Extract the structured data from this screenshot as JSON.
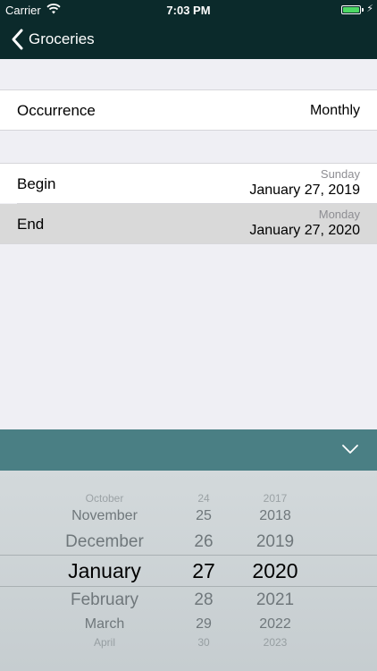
{
  "status": {
    "carrier": "Carrier",
    "time": "7:03 PM"
  },
  "nav": {
    "back_label": "Groceries"
  },
  "occurrence": {
    "label": "Occurrence",
    "value": "Monthly"
  },
  "begin": {
    "label": "Begin",
    "weekday": "Sunday",
    "date": "January 27, 2019"
  },
  "end": {
    "label": "End",
    "weekday": "Monday",
    "date": "January 27, 2020"
  },
  "picker": {
    "months": [
      "October",
      "November",
      "December",
      "January",
      "February",
      "March",
      "April"
    ],
    "days": [
      "24",
      "25",
      "26",
      "27",
      "28",
      "29",
      "30"
    ],
    "years": [
      "2017",
      "2018",
      "2019",
      "2020",
      "2021",
      "2022",
      "2023"
    ],
    "selected_index": 3
  },
  "colors": {
    "nav_bg": "#0b2a2b",
    "toolbar_bg": "#4a7f84",
    "battery": "#4cd964",
    "selected_row": "#d9d9d9"
  }
}
